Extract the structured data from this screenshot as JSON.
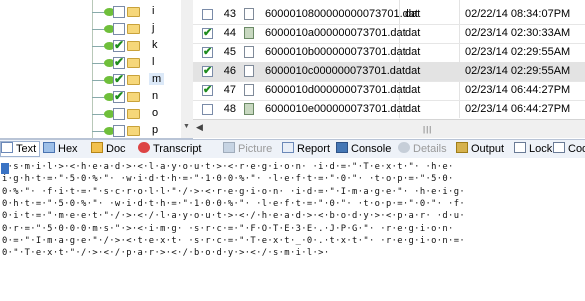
{
  "tree": {
    "items": [
      {
        "label": "i",
        "checked": false
      },
      {
        "label": "j",
        "checked": false
      },
      {
        "label": "k",
        "checked": true
      },
      {
        "label": "l",
        "checked": true
      },
      {
        "label": "m",
        "checked": true,
        "selected": true
      },
      {
        "label": "n",
        "checked": true
      },
      {
        "label": "o",
        "checked": false
      },
      {
        "label": "p",
        "checked": false
      }
    ]
  },
  "files": {
    "rows": [
      {
        "num": "43",
        "name": "6000010800000000073701.dat",
        "type": "dat",
        "date": "02/22/14 08:34:07PM",
        "checked": false,
        "icon": "file-icon",
        "selected": false
      },
      {
        "num": "44",
        "name": "6000010a000000073701.dat",
        "type": "dat",
        "date": "02/23/14 02:30:33AM",
        "checked": true,
        "icon": "image-file-icon",
        "selected": false
      },
      {
        "num": "45",
        "name": "6000010b000000073701.dat",
        "type": "dat",
        "date": "02/23/14 02:29:55AM",
        "checked": true,
        "icon": "file-icon",
        "selected": false
      },
      {
        "num": "46",
        "name": "6000010c000000073701.dat",
        "type": "dat",
        "date": "02/23/14 02:29:55AM",
        "checked": true,
        "icon": "file-icon",
        "selected": true
      },
      {
        "num": "47",
        "name": "6000010d000000073701.dat",
        "type": "dat",
        "date": "02/23/14 06:44:27PM",
        "checked": true,
        "icon": "file-icon",
        "selected": false
      },
      {
        "num": "48",
        "name": "6000010e000000073701.dat",
        "type": "dat",
        "date": "02/23/14 06:44:27PM",
        "checked": false,
        "icon": "image-file-icon",
        "selected": false
      }
    ]
  },
  "toolbar": {
    "text": "Text",
    "hex": "Hex",
    "doc": "Doc",
    "transcript": "Transcript",
    "picture": "Picture",
    "report": "Report",
    "console": "Console",
    "details": "Details",
    "output": "Output",
    "lock": "Lock",
    "codepage": "Codepage"
  },
  "content": {
    "lines": [
      "c·s·m·i·l·>·<·h·e·a·d·>·<·l·a·y·o·u·t·>·<·r·e·g·i·o·n· ·i·d·=·\"·T·e·x·t·\"· ·h·e·",
      "i·g·h·t·=·\"·5·0·%·\"· ·w·i·d·t·h·=·\"·1·0·0·%·\"· ·l·e·f·t·=·\"·0·\"· ·t·o·p·=·\"·5·0·",
      "0·%·\"· ·f·i·t·=·\"·s·c·r·o·l·l·\"·/·>·<·r·e·g·i·o·n· ·i·d·=·\"·I·m·a·g·e·\"· ·h·e·i·g·",
      "0·h·t·=·\"·5·0·%·\"· ·w·i·d·t·h·=·\"·1·0·0·%·\"· ·l·e·f·t·=·\"·0·\"· ·t·o·p·=·\"·0·\"· ·f·",
      "0·i·t·=·\"·m·e·e·t·\"·/·>·<·/·l·a·y·o·u·t·>·<·/·h·e·a·d·>·<·b·o·d·y·>·<·p·a·r· ·d·u·",
      "0·r·=·\"·5·0·0·0·m·s·\"·>·<·i·m·g· ·s·r·c·=·\"·F·O·T·E·3·E·.·J·P·G·\"· ·r·e·g·i·o·n·",
      "0·=·\"·I·m·a·g·e·\"·/·>·<·t·e·x·t· ·s·r·c·=·\"·T·e·x·t·_·0·.·t·x·t·\"· ·r·e·g·i·o·n·=·",
      "0·\"·T·e·x·t·\"·/·>·<·/·p·a·r·>·<·/·b·o·d·y·>·<·/·s·m·i·l·>·"
    ]
  }
}
